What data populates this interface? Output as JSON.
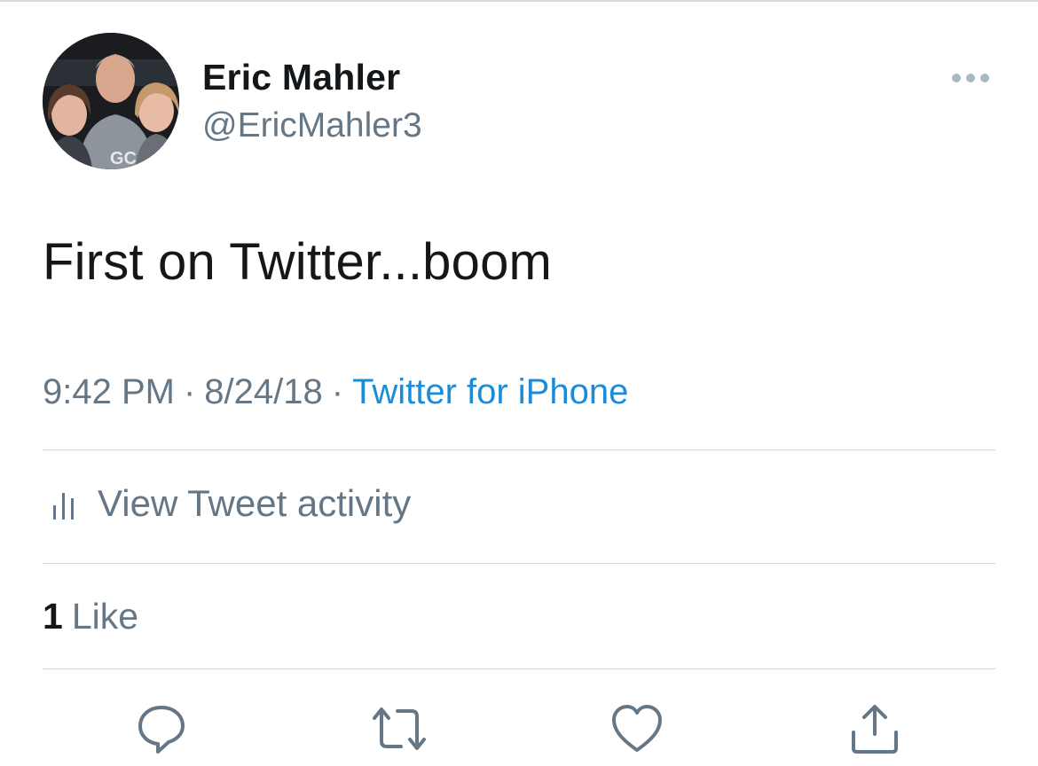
{
  "tweet": {
    "author": {
      "display_name": "Eric Mahler",
      "handle": "@EricMahler3",
      "avatar": "profile-photo"
    },
    "text": "First on Twitter...boom",
    "time": "9:42 PM",
    "date": "8/24/18",
    "separator": "·",
    "source": "Twitter for iPhone",
    "activity_label": "View Tweet activity",
    "likes": {
      "count": "1",
      "label": "Like"
    }
  },
  "actions": [
    {
      "name": "reply",
      "icon": "speech-bubble-icon"
    },
    {
      "name": "retweet",
      "icon": "retweet-arrows-icon"
    },
    {
      "name": "like",
      "icon": "heart-icon"
    },
    {
      "name": "share",
      "icon": "share-arrow-icon"
    }
  ],
  "colors": {
    "text_primary": "#14171a",
    "text_secondary": "#657786",
    "link": "#1d8cd8",
    "divider": "#d6d9db"
  }
}
